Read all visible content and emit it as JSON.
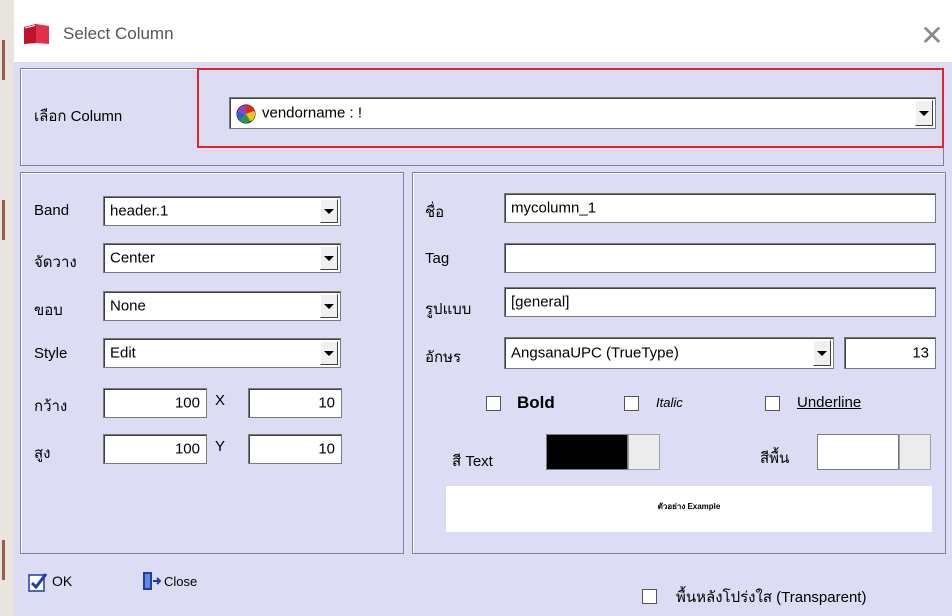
{
  "window": {
    "title": "Select Column",
    "close_icon": "close-icon"
  },
  "column_select": {
    "label": "เลือก Column",
    "value": "vendorname : !",
    "icon": "color-wheel-icon"
  },
  "left": {
    "band_label": "Band",
    "band_value": "header.1",
    "align_label": "จัดวาง",
    "align_value": "Center",
    "border_label": "ขอบ",
    "border_value": "None",
    "style_label": "Style",
    "style_value": "Edit",
    "width_label": "กว้าง",
    "width_value": "100",
    "x_label": "X",
    "x_value": "10",
    "height_label": "สูง",
    "height_value": "100",
    "y_label": "Y",
    "y_value": "10"
  },
  "right": {
    "name_label": "ชื่อ",
    "name_value": "mycolumn_1",
    "tag_label": "Tag",
    "tag_value": "",
    "format_label": "รูปแบบ",
    "format_value": "[general]",
    "font_label": "อักษร",
    "font_value": "AngsanaUPC (TrueType)",
    "font_size": "13",
    "bold_label": "Bold",
    "italic_label": "Italic",
    "underline_label": "Underline",
    "text_color_label": "สี Text",
    "text_color": "#000000",
    "bg_color_label": "สีพื้น",
    "bg_color": "#ffffff",
    "preview_text": "ตัวอย่าง Example"
  },
  "footer": {
    "ok_label": "OK",
    "close_label": "Close",
    "transparent_label": "พื้นหลังโปร่งใส (Transparent)"
  },
  "colors": {
    "dialog_bg": "#dcdcf4",
    "highlight": "#e0262a"
  }
}
